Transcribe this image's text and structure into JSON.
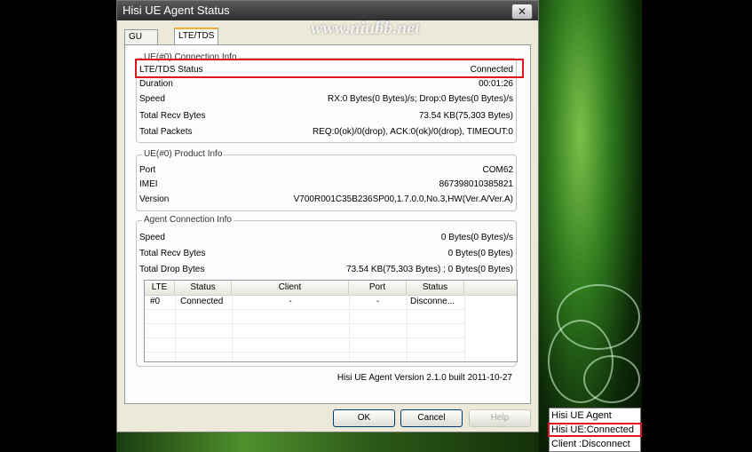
{
  "window": {
    "title": "Hisi UE Agent Status",
    "close_label": "✕"
  },
  "watermark": "www.niubb.net",
  "tabs": [
    {
      "label": "GU Status"
    },
    {
      "label": "LTE/TDS Status"
    }
  ],
  "ue_connection": {
    "title": "UE(#0) Connection Info",
    "rows": [
      {
        "key": "LTE/TDS Status",
        "value": "Connected"
      },
      {
        "key": "Duration",
        "value": "00:01:26"
      },
      {
        "key": "Speed",
        "value": "RX:0 Bytes(0 Bytes)/s; Drop:0 Bytes(0 Bytes)/s"
      },
      {
        "key": "Total Recv Bytes",
        "value": "73.54 KB(75,303 Bytes)"
      },
      {
        "key": "Total Packets",
        "value": "REQ:0(ok)/0(drop), ACK:0(ok)/0(drop), TIMEOUT:0"
      }
    ]
  },
  "ue_product": {
    "title": "UE(#0) Product Info",
    "rows": [
      {
        "key": "Port",
        "value": "COM62"
      },
      {
        "key": "IMEI",
        "value": "867398010385821"
      },
      {
        "key": "Version",
        "value": "V700R001C35B236SP00,1.7.0.0,No.3,HW(Ver.A/Ver.A)"
      }
    ]
  },
  "agent_connection": {
    "title": "Agent Connection Info",
    "rows": [
      {
        "key": "Speed",
        "value": "0 Bytes(0 Bytes)/s"
      },
      {
        "key": "Total Recv Bytes",
        "value": "0 Bytes(0 Bytes)"
      },
      {
        "key": "Total Drop Bytes",
        "value": "73.54 KB(75,303 Bytes) ; 0 Bytes(0 Bytes)"
      }
    ],
    "table": {
      "columns": [
        "LTE",
        "Status",
        "Client",
        "Port",
        "Status"
      ],
      "rows": [
        [
          "#0",
          "Connected",
          "-",
          "-",
          "Disconne..."
        ]
      ]
    }
  },
  "version_text": "Hisi UE Agent Version 2.1.0 built 2011-10-27",
  "buttons": {
    "ok": "OK",
    "cancel": "Cancel",
    "help": "Help"
  },
  "tray_menu": [
    {
      "label": "Hisi UE Agent"
    },
    {
      "label": "Hisi UE:Connected"
    },
    {
      "label": "Client :Disconnect"
    }
  ]
}
